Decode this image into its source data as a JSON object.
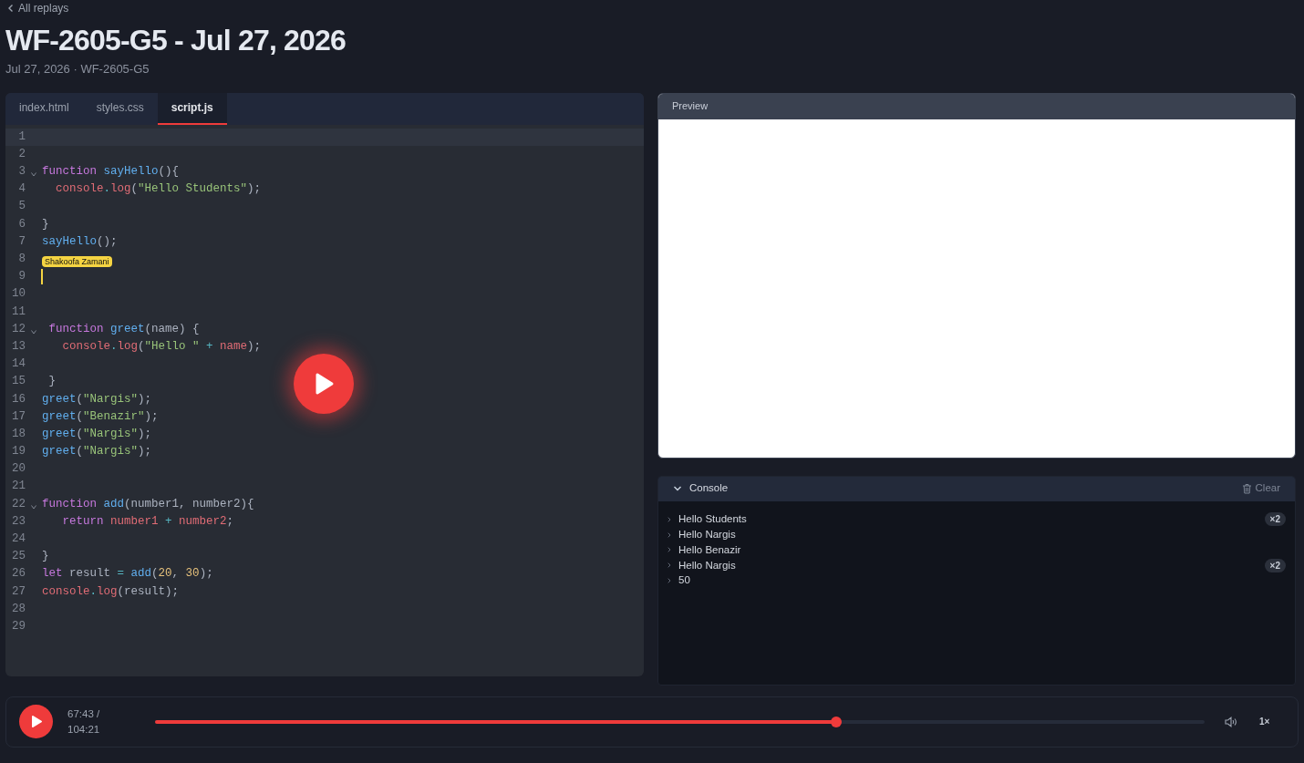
{
  "back_link": "All replays",
  "title": "WF-2605-G5 - Jul 27, 2026",
  "subtitle": "Jul 27, 2026 · WF-2605-G5",
  "editor": {
    "tabs": [
      {
        "label": "index.html",
        "selected": false
      },
      {
        "label": "styles.css",
        "selected": false
      },
      {
        "label": "script.js",
        "selected": true
      }
    ],
    "lines": [
      {
        "number": "1",
        "active": true
      },
      {
        "number": "2"
      },
      {
        "number": "3",
        "fold": true,
        "tokens": [
          {
            "kind": "keyword",
            "text": "function "
          },
          {
            "kind": "func",
            "text": "sayHello"
          },
          {
            "kind": "plain",
            "text": "(){"
          }
        ]
      },
      {
        "number": "4",
        "tokens": [
          {
            "kind": "var",
            "text": "  console"
          },
          {
            "kind": "op",
            "text": "."
          },
          {
            "kind": "var",
            "text": "log"
          },
          {
            "kind": "plain",
            "text": "("
          },
          {
            "kind": "string",
            "text": "\"Hello Students\""
          },
          {
            "kind": "plain",
            "text": ");"
          }
        ]
      },
      {
        "number": "5"
      },
      {
        "number": "6",
        "tokens": [
          {
            "kind": "plain",
            "text": "}"
          }
        ]
      },
      {
        "number": "7",
        "tokens": [
          {
            "kind": "func",
            "text": "sayHello"
          },
          {
            "kind": "plain",
            "text": "();"
          }
        ]
      },
      {
        "number": "8"
      },
      {
        "number": "9",
        "remote_cursor": "Shakoofa Zamani"
      },
      {
        "number": "10"
      },
      {
        "number": "11"
      },
      {
        "number": "12",
        "fold": true,
        "tokens": [
          {
            "kind": "keyword",
            "text": " function "
          },
          {
            "kind": "func",
            "text": "greet"
          },
          {
            "kind": "plain",
            "text": "(name) {"
          }
        ]
      },
      {
        "number": "13",
        "tokens": [
          {
            "kind": "var",
            "text": "   console"
          },
          {
            "kind": "op",
            "text": "."
          },
          {
            "kind": "var",
            "text": "log"
          },
          {
            "kind": "plain",
            "text": "("
          },
          {
            "kind": "string",
            "text": "\"Hello \""
          },
          {
            "kind": "op",
            "text": " + "
          },
          {
            "kind": "var",
            "text": "name"
          },
          {
            "kind": "plain",
            "text": ");"
          }
        ]
      },
      {
        "number": "14"
      },
      {
        "number": "15",
        "tokens": [
          {
            "kind": "plain",
            "text": " }"
          }
        ]
      },
      {
        "number": "16",
        "tokens": [
          {
            "kind": "func",
            "text": "greet"
          },
          {
            "kind": "plain",
            "text": "("
          },
          {
            "kind": "string",
            "text": "\"Nargis\""
          },
          {
            "kind": "plain",
            "text": ");"
          }
        ]
      },
      {
        "number": "17",
        "tokens": [
          {
            "kind": "func",
            "text": "greet"
          },
          {
            "kind": "plain",
            "text": "("
          },
          {
            "kind": "string",
            "text": "\"Benazir\""
          },
          {
            "kind": "plain",
            "text": ");"
          }
        ]
      },
      {
        "number": "18",
        "tokens": [
          {
            "kind": "func",
            "text": "greet"
          },
          {
            "kind": "plain",
            "text": "("
          },
          {
            "kind": "string",
            "text": "\"Nargis\""
          },
          {
            "kind": "plain",
            "text": ");"
          }
        ]
      },
      {
        "number": "19",
        "tokens": [
          {
            "kind": "func",
            "text": "greet"
          },
          {
            "kind": "plain",
            "text": "("
          },
          {
            "kind": "string",
            "text": "\"Nargis\""
          },
          {
            "kind": "plain",
            "text": ");"
          }
        ]
      },
      {
        "number": "20"
      },
      {
        "number": "21"
      },
      {
        "number": "22",
        "fold": true,
        "tokens": [
          {
            "kind": "keyword",
            "text": "function "
          },
          {
            "kind": "func",
            "text": "add"
          },
          {
            "kind": "plain",
            "text": "(number1, number2){"
          }
        ]
      },
      {
        "number": "23",
        "tokens": [
          {
            "kind": "keyword",
            "text": "   return "
          },
          {
            "kind": "var",
            "text": "number1"
          },
          {
            "kind": "op",
            "text": " + "
          },
          {
            "kind": "var",
            "text": "number2"
          },
          {
            "kind": "plain",
            "text": ";"
          }
        ]
      },
      {
        "number": "24"
      },
      {
        "number": "25",
        "tokens": [
          {
            "kind": "plain",
            "text": "}"
          }
        ]
      },
      {
        "number": "26",
        "tokens": [
          {
            "kind": "keyword",
            "text": "let "
          },
          {
            "kind": "plain",
            "text": "result "
          },
          {
            "kind": "op",
            "text": "= "
          },
          {
            "kind": "func",
            "text": "add"
          },
          {
            "kind": "plain",
            "text": "("
          },
          {
            "kind": "number",
            "text": "20"
          },
          {
            "kind": "plain",
            "text": ", "
          },
          {
            "kind": "number",
            "text": "30"
          },
          {
            "kind": "plain",
            "text": ");"
          }
        ]
      },
      {
        "number": "27",
        "tokens": [
          {
            "kind": "var",
            "text": "console"
          },
          {
            "kind": "op",
            "text": "."
          },
          {
            "kind": "var",
            "text": "log"
          },
          {
            "kind": "plain",
            "text": "(result);"
          }
        ]
      },
      {
        "number": "28"
      },
      {
        "number": "29"
      }
    ]
  },
  "preview": {
    "title": "Preview"
  },
  "console": {
    "title": "Console",
    "clear": "Clear",
    "expanded": true,
    "entries": [
      {
        "text": "Hello Students",
        "count": "×2"
      },
      {
        "text": "Hello Nargis"
      },
      {
        "text": "Hello Benazir"
      },
      {
        "text": "Hello Nargis",
        "count": "×2"
      },
      {
        "text": "50"
      }
    ]
  },
  "player": {
    "time": "67:43 /",
    "duration": "104:21",
    "level": 0.649,
    "speed": "1×"
  }
}
